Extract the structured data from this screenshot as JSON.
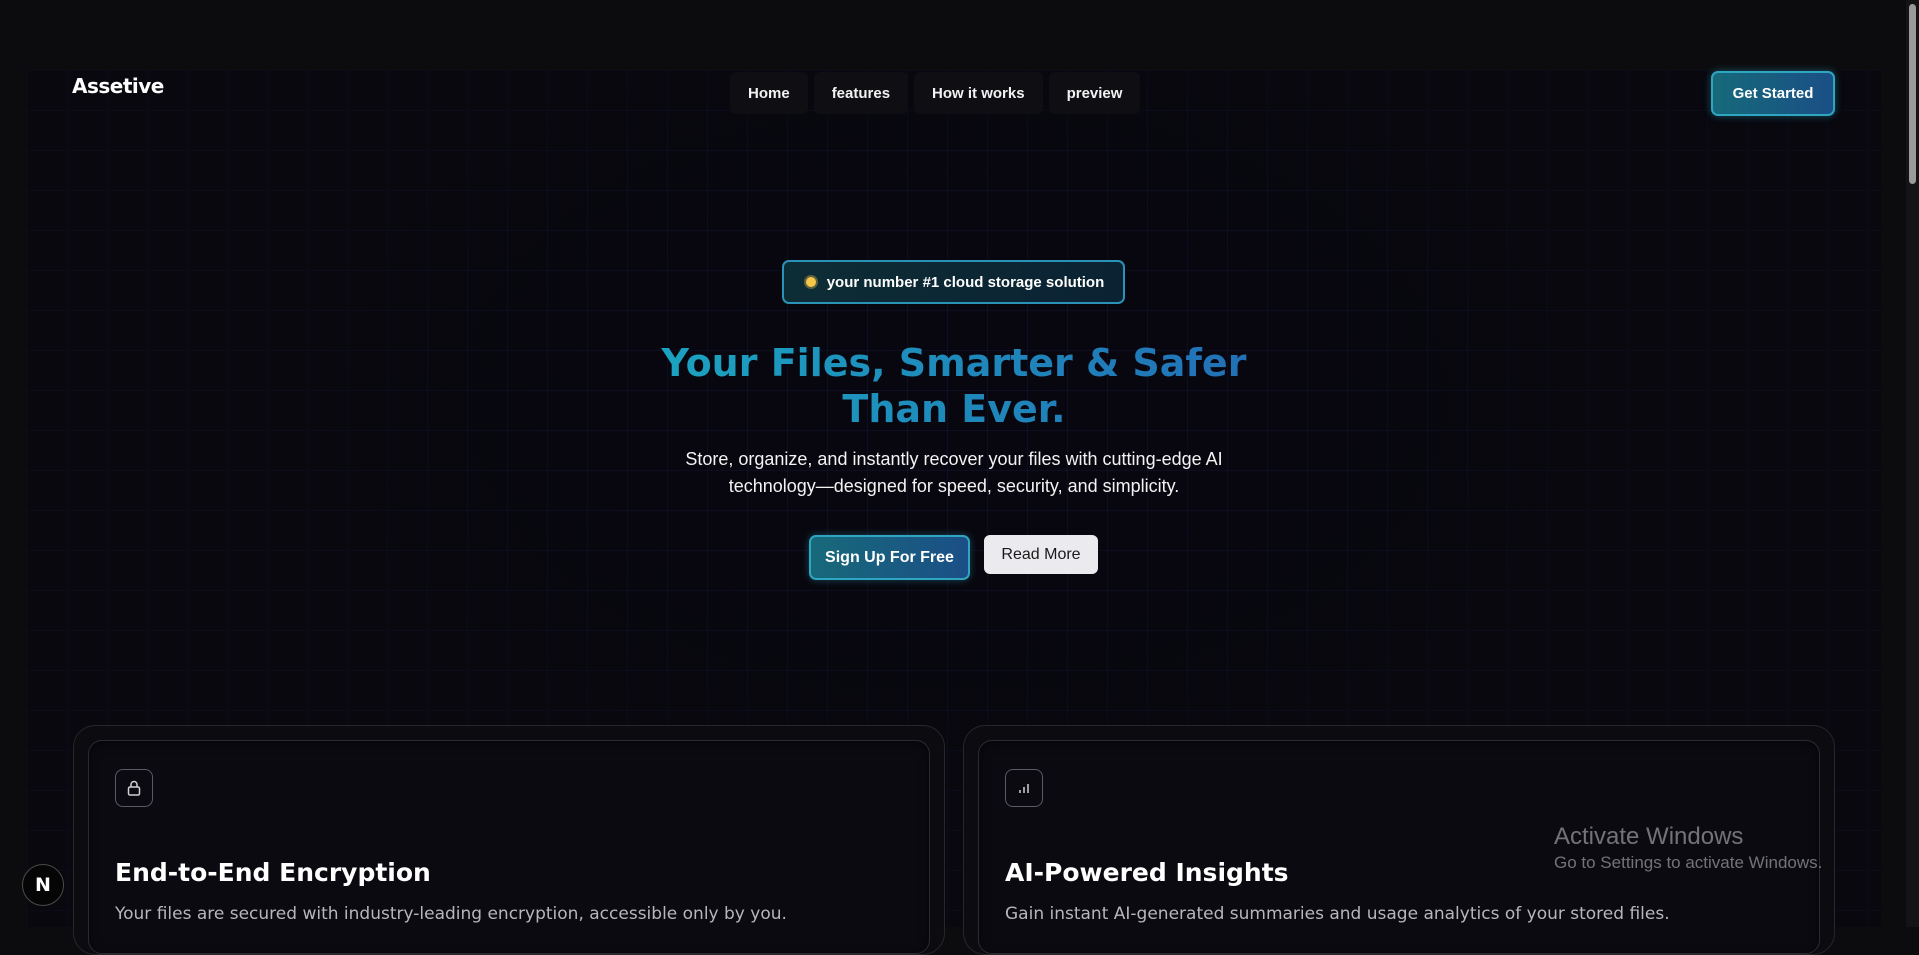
{
  "brand": {
    "name": "Assetive"
  },
  "nav": {
    "items": [
      {
        "label": "Home"
      },
      {
        "label": "features"
      },
      {
        "label": "How it works"
      },
      {
        "label": "preview"
      }
    ]
  },
  "header": {
    "cta_label": "Get Started"
  },
  "hero": {
    "badge_icon": "sun-icon",
    "badge_text": "your number #1 cloud storage solution",
    "title_line1": "Your Files, Smarter & Safer",
    "title_line2": "Than Ever.",
    "subtitle_line1": "Store, organize, and instantly recover your files with cutting-edge AI",
    "subtitle_line2": "technology—designed for speed, security, and simplicity.",
    "primary_button": "Sign Up For Free",
    "secondary_button": "Read More"
  },
  "features": [
    {
      "icon": "lock-icon",
      "title": "End-to-End Encryption",
      "description": "Your files are secured with industry-leading encryption, accessible only by you."
    },
    {
      "icon": "bar-chart-icon",
      "title": "AI-Powered Insights",
      "description": "Gain instant AI-generated summaries and usage analytics of your stored files."
    }
  ],
  "system": {
    "activate_title": "Activate Windows",
    "activate_subtitle": "Go to Settings to activate Windows.",
    "dev_badge": "N"
  },
  "colors": {
    "accent_teal": "#1ba3c0",
    "accent_blue": "#2270b6",
    "background": "#08070f",
    "grid": "#253d96"
  }
}
